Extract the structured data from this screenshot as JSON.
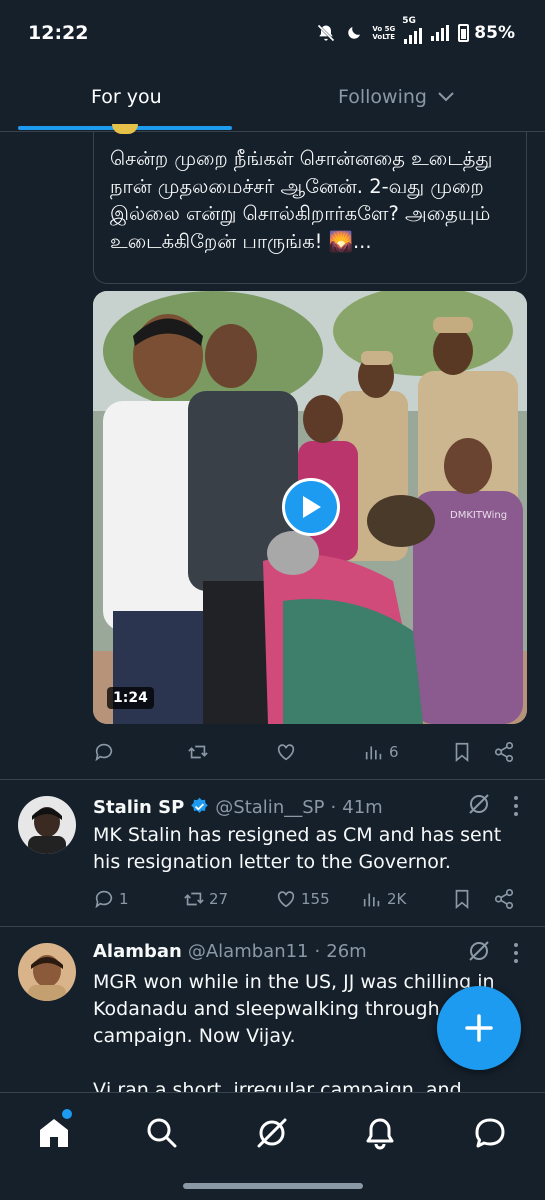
{
  "status_bar": {
    "time": "12:22",
    "battery": "85%",
    "volte_top": "Vo 5G",
    "volte_bottom": "VoLTE",
    "network_label": "5G"
  },
  "tabs": [
    {
      "label": "For you"
    },
    {
      "label": "Following"
    }
  ],
  "quoted_post": {
    "text": "சென்ற முறை நீங்கள் சொன்னதை உடைத்து நான் முதலமைச்சர் ஆனேன். 2-வது முறை இல்லை என்று சொல்கிறார்களே? அதையும் உடைக்கிறேன் பாருங்க! 🌄...",
    "video_duration": "1:24",
    "watermark": "DMKITWing"
  },
  "post_actions_1": {
    "views": "6"
  },
  "tweets": [
    {
      "name": "Stalin SP",
      "handle": "@Stalin__SP",
      "separator": "·",
      "time": "41m",
      "text": "MK Stalin has resigned as CM and has sent his resignation letter to the Governor.",
      "replies": "1",
      "reposts": "27",
      "likes": "155",
      "views": "2K"
    },
    {
      "name": "Alamban",
      "handle": "@Alamban11",
      "separator": "·",
      "time": "26m",
      "text_line1": "MGR won while in the US, JJ was chilling in",
      "text_line2": "Kodanadu and sleepwalking through his",
      "text_line3": "campaign. Now Vijay.",
      "text_line4": "Vj ran a short, irregular campaign, and, except"
    }
  ],
  "colors": {
    "background": "#15202b",
    "accent": "#1d9bf0",
    "secondary_text": "#8b98a5",
    "border": "#38444d"
  },
  "icons": [
    "home-icon",
    "search-icon",
    "grok-icon",
    "notifications-icon",
    "messages-icon",
    "compose-plus-icon"
  ]
}
